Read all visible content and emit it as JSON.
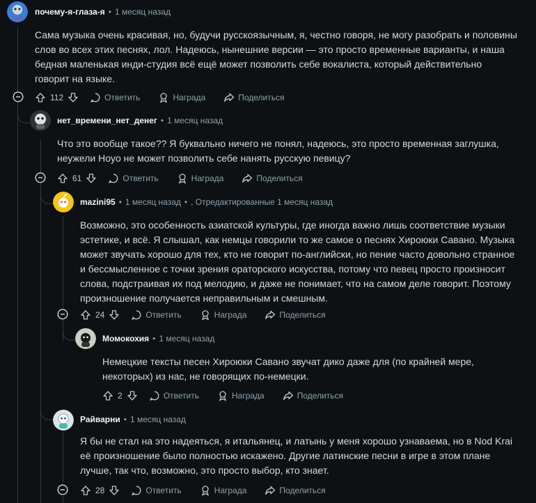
{
  "comments": [
    {
      "author": "почему-я-глаза-я",
      "time": "1 месяц назад",
      "body": "Сама музыка очень красивая, но, будучи русскоязычным, я, честно говоря, не могу разобрать и половины слов во всех этих песнях, лол. Надеюсь, нынешние версии — это просто временные варианты, и наша бедная маленькая инди-студия всё ещё может позволить себе вокалиста, который действительно говорит на языке.",
      "votes": "112"
    },
    {
      "author": "нет_времени_нет_денег",
      "time": "1 месяц назад",
      "body": "Что это вообще такое?? Я буквально ничего не понял, надеюсь, это просто временная заглушка, неужели Hoyo не может позволить себе нанять русскую певицу?",
      "votes": "61"
    },
    {
      "author": "mazini95",
      "time": "1 месяц назад",
      "edited": ", Отредактированные 1 месяц назад",
      "body": "Возможно, это особенность азиатской культуры, где иногда важно лишь соответствие музыки эстетике, и всё. Я слышал, как немцы говорили то же самое о песнях Хироюки Савано. Музыка может звучать хорошо для тех, кто не говорит по-английски, но пение часто довольно странное и бессмысленное с точки зрения ораторского искусства, потому что певец просто произносит слова, подстраивая их под мелодию, и даже не понимает, что на самом деле говорит. Поэтому произношение получается неправильным и смешным.",
      "votes": "24"
    },
    {
      "author": "Момокохия",
      "time": "1 месяц назад",
      "body": "Немецкие тексты песен Хироюки Савано звучат дико даже для (по крайней мере, некоторых) из нас, не говорящих по-немецки.",
      "votes": "2"
    },
    {
      "author": "Райварни",
      "time": "1 месяц назад",
      "body": "Я бы не стал на это надеяться, я итальянец, и латынь у меня хорошо узнаваема, но в Nod Krai её произношение было полностью искажено. Другие латинские песни в игре в этом плане лучше, так что, возможно, это просто выбор, кто знает.",
      "votes": "28"
    }
  ],
  "actions": {
    "reply": "Ответить",
    "award": "Награда",
    "share": "Поделиться"
  },
  "dot": "•",
  "icons": [
    "upvote-icon",
    "downvote-icon",
    "comment-icon",
    "award-icon",
    "share-icon",
    "collapse-icon",
    "avatar"
  ]
}
